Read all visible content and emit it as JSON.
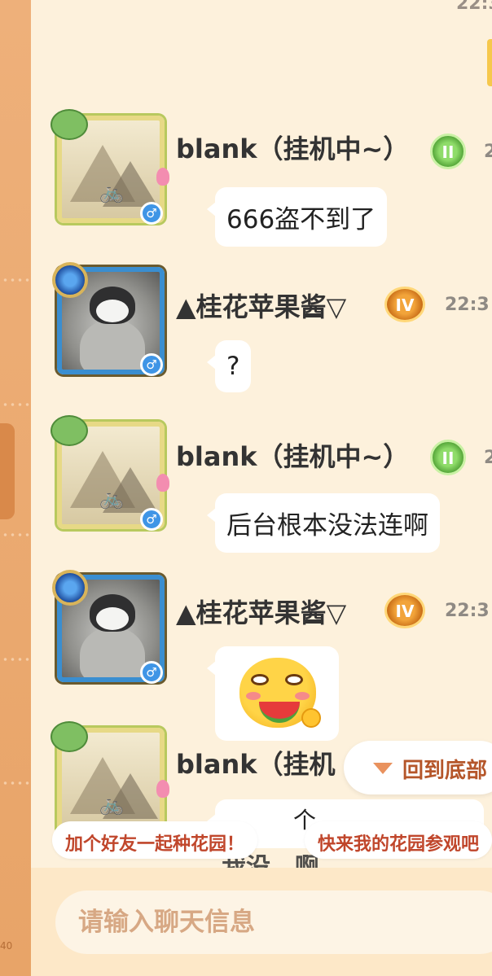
{
  "top_time_partial": "22:3",
  "messages": [
    {
      "user": "blank（挂机中~）",
      "avatar": "landscape-painting-avatar",
      "level_badge": "II",
      "time": "2",
      "text": "666盗不到了"
    },
    {
      "user": "▲桂花苹果酱▽",
      "avatar": "penguin-avatar",
      "level_badge": "IV",
      "time": "22:3",
      "text": "?"
    },
    {
      "user": "blank（挂机中~）",
      "avatar": "landscape-painting-avatar",
      "level_badge": "II",
      "time": "2",
      "text": "后台根本没法连啊"
    },
    {
      "user": "▲桂花苹果酱▽",
      "avatar": "penguin-avatar",
      "level_badge": "IV",
      "time": "22:3",
      "sticker": "watermelon-eating-emoji"
    },
    {
      "user": "blank（挂机",
      "avatar": "landscape-painting-avatar",
      "level_badge": "II",
      "text_partial": "个"
    }
  ],
  "gender_symbol": "♂",
  "back_to_bottom_label": "回到底部",
  "quick_chips": [
    "加个好友一起种花园！",
    "快来我的花园参观吧"
  ],
  "partial_line": "我没…啊",
  "input": {
    "placeholder": "请输入聊天信息",
    "value": ""
  },
  "left_rail_number": "40",
  "colors": {
    "accent": "#e9a56a",
    "panel": "#fdf1dc",
    "chip_text": "#c0462b"
  }
}
